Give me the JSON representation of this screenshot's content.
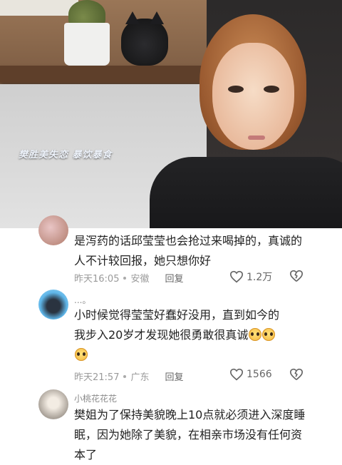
{
  "video": {
    "caption": "樊胜美失恋 暴饮暴食"
  },
  "comments": [
    {
      "username": "",
      "text": "是泻药的话邱莹莹也会抢过来喝掉的，真诚的人不计较回报，她只想你好",
      "time": "昨天16:05",
      "location": "安徽",
      "reply_label": "回复",
      "likes": "1.2万"
    },
    {
      "username": "...。",
      "text_line1": "小时候觉得莹莹好蠢好没用，直到如今的",
      "text_line2": "我步入20岁才发现她很勇敢很真诚",
      "time": "昨天21:57",
      "location": "广东",
      "reply_label": "回复",
      "likes": "1566"
    },
    {
      "username": "小桃花花花",
      "text": "樊姐为了保持美貌晚上10点就必须进入深度睡眠，因为她除了美貌，在相亲市场没有任何资本了"
    }
  ],
  "colors": {
    "text": "#222222",
    "meta": "#9a9a9a",
    "caption": "#eef3fb"
  }
}
